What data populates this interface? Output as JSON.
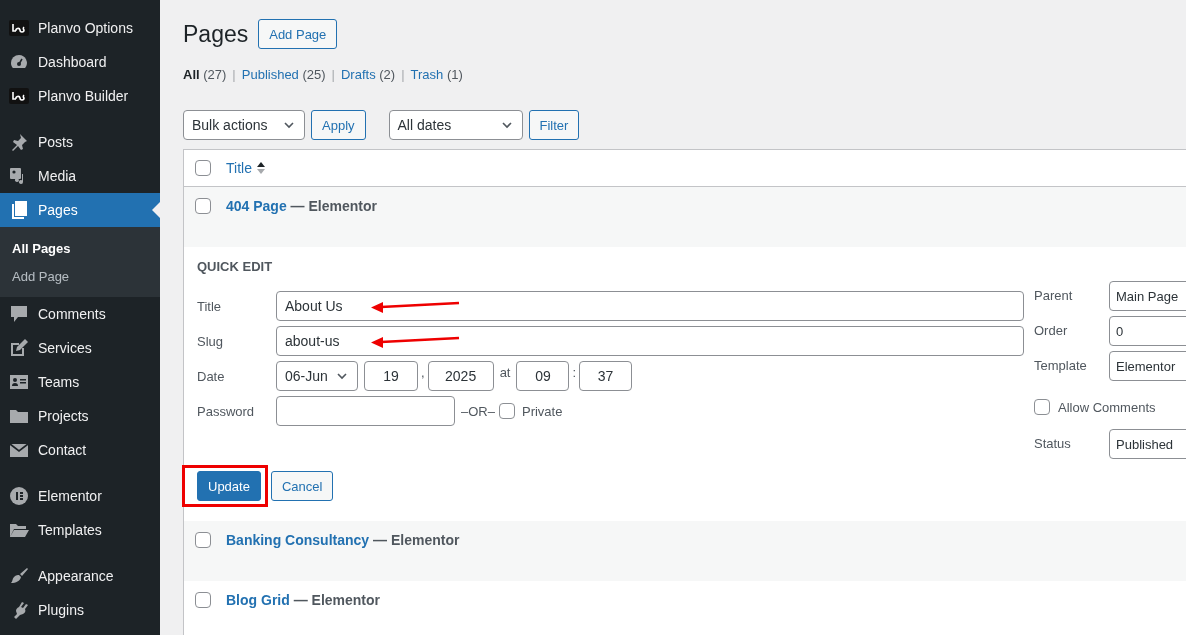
{
  "sidebar": {
    "groups": [
      {
        "items": [
          {
            "label": "Planvo Options",
            "selected": false
          },
          {
            "label": "Dashboard",
            "selected": false
          },
          {
            "label": "Planvo Builder",
            "selected": false
          }
        ]
      },
      {
        "items": [
          {
            "label": "Posts",
            "selected": false
          },
          {
            "label": "Media",
            "selected": false
          },
          {
            "label": "Pages",
            "selected": true,
            "children": [
              {
                "label": "All Pages",
                "selected": true
              },
              {
                "label": "Add Page",
                "selected": false
              }
            ]
          },
          {
            "label": "Comments",
            "selected": false
          },
          {
            "label": "Services",
            "selected": false
          },
          {
            "label": "Teams",
            "selected": false
          },
          {
            "label": "Projects",
            "selected": false
          },
          {
            "label": "Contact",
            "selected": false
          }
        ]
      },
      {
        "items": [
          {
            "label": "Elementor",
            "selected": false
          },
          {
            "label": "Templates",
            "selected": false
          }
        ]
      },
      {
        "items": [
          {
            "label": "Appearance",
            "selected": false
          },
          {
            "label": "Plugins",
            "selected": false
          }
        ]
      }
    ]
  },
  "header": {
    "title": "Pages",
    "add_button": "Add Page"
  },
  "views": {
    "separator": "|",
    "items": [
      {
        "label": "All",
        "count": "(27)",
        "selected": true
      },
      {
        "label": "Published",
        "count": "(25)",
        "selected": false
      },
      {
        "label": "Drafts",
        "count": "(2)",
        "selected": false
      },
      {
        "label": "Trash",
        "count": "(1)",
        "selected": false
      }
    ]
  },
  "tablenav": {
    "bulk_select": "Bulk actions",
    "apply": "Apply",
    "date_select": "All dates",
    "filter": "Filter"
  },
  "table": {
    "select_all_checked": false,
    "columns": [
      {
        "label": "Title",
        "sortable": true
      }
    ],
    "rows": [
      {
        "kind": "row",
        "title": "404 Page",
        "state": "— Elementor",
        "checked": false
      },
      {
        "kind": "quick_edit",
        "heading": "QUICK EDIT",
        "title": {
          "label": "Title",
          "value": "About Us",
          "pointed": true
        },
        "slug": {
          "label": "Slug",
          "value": "about-us",
          "pointed": true
        },
        "date": {
          "label": "Date",
          "month": "06-Jun",
          "day": "19",
          "day_sep": ",",
          "year": "2025",
          "at": "at",
          "hour": "09",
          "time_sep": ":",
          "minute": "37"
        },
        "password": {
          "label": "Password"
        },
        "or": "–OR–",
        "private": {
          "label": "Private",
          "checked": false
        },
        "parent": {
          "label": "Parent",
          "value": "Main Page"
        },
        "order": {
          "label": "Order",
          "value": "0"
        },
        "template": {
          "label": "Template",
          "value": "Elementor"
        },
        "allow_comments": {
          "label": "Allow Comments",
          "checked": false
        },
        "status": {
          "label": "Status",
          "value": "Published"
        },
        "update": {
          "label": "Update",
          "highlighted": true
        },
        "cancel": "Cancel"
      },
      {
        "kind": "row",
        "title": "Banking Consultancy",
        "state": "— Elementor",
        "checked": false
      },
      {
        "kind": "row",
        "title": "Blog Grid",
        "state": "— Elementor",
        "checked": false
      }
    ]
  }
}
